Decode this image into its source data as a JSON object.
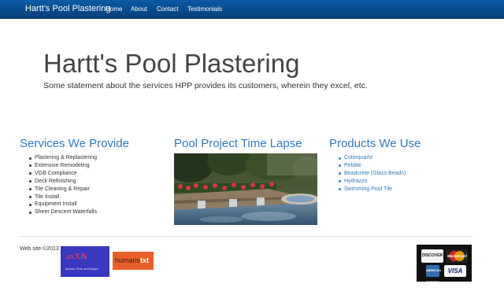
{
  "nav": {
    "brand": "Hartt's Pool Plastering",
    "items": [
      "Home",
      "About",
      "Contact",
      "Testimonials"
    ]
  },
  "hero": {
    "title": "Hartt's Pool Plastering",
    "subtitle": "Some statement about the services HPP provides its customers, wherein they excel, etc."
  },
  "services": {
    "heading": "Services We Provide",
    "items": [
      "Plastering & Replastering",
      "Extensive Remodeling",
      "VGB Compliance",
      "Deck Refinishing",
      "Tile Cleaning & Repair",
      "Tile Install",
      "Equipment Install",
      "Sheer Descent Waterfalls"
    ]
  },
  "timelapse": {
    "heading": "Pool Project Time Lapse"
  },
  "products": {
    "heading": "Products We Use",
    "items": [
      "Colorquartz",
      "Pebble",
      "Beadcrete (Glass Beads)",
      "Hydrazzo",
      "Swimming Pool Tile"
    ]
  },
  "footer": {
    "copyright": "Web site ©2013",
    "logo_axx": {
      "mark": "axX&",
      "tagline": "Across Time and Space"
    },
    "logo_humans": {
      "text": "humanstxt"
    },
    "cards": {
      "discover": "DISCOVER",
      "mastercard": "MasterCard",
      "amex": "AMERICAN EXPRESS",
      "visa": "VISA"
    }
  },
  "colors": {
    "nav_bg": "#0b4f94",
    "link": "#2f7ab9",
    "text": "#333333"
  }
}
